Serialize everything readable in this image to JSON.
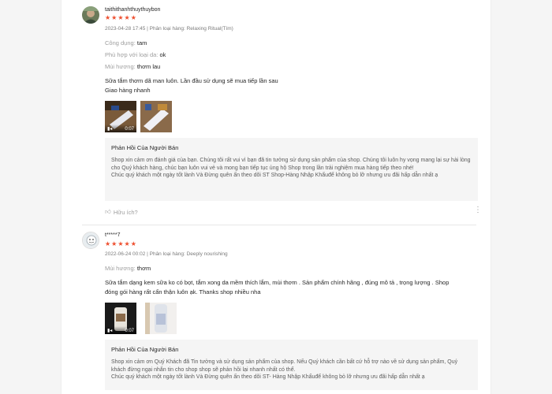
{
  "colors": {
    "star": "#ee4d2d",
    "reply_bg": "#f5f5f5"
  },
  "reviews": [
    {
      "author": "taithithanhthuythuybon",
      "stars": "★★★★★",
      "meta": "2023-04-28 17:45 | Phân loại hàng: Relaxing Ritual(Tím)",
      "attrs": [
        {
          "key": "Công dụng:",
          "value": "tam"
        },
        {
          "key": "Phù hợp với loại da:",
          "value": "ok"
        },
        {
          "key": "Mùi hương:",
          "value": "thơm lau"
        }
      ],
      "text_lines": [
        "Sữa tắm thơm dã man luôn. Lần đầu sử dụng sẽ mua tiếp lần sau",
        "Giao hàng nhanh"
      ],
      "media": [
        {
          "kind": "video",
          "duration": "0:07"
        },
        {
          "kind": "image"
        }
      ],
      "reply_title": "Phản Hồi Của Người Bán",
      "reply_text": "Shop xin cảm ơn đánh giá của bạn. Chúng tôi rất vui vì bạn đã tin tưởng sử dụng sản phẩm của shop. Chúng tôi luôn hy vọng mang lại sự hài lòng cho Quý khách hàng, chúc bạn luôn vui vẻ và mong bạn tiếp tục ủng hộ Shop trong lần trải nghiệm mua hàng tiếp theo nhé!\nChúc quý khách một ngày tốt lành Và Đừng quên ấn theo dõi  ST Shop-Hàng Nhập Khẩuđể không bỏ lỡ nhưng ưu đãi hấp dẫn nhất ạ",
      "helpful": "Hữu ích?"
    },
    {
      "author": "t*****7",
      "stars": "★★★★★",
      "meta": "2022-06-24 00:02 | Phân loại hàng: Deeply nourishing",
      "attrs": [
        {
          "key": "Mùi hương:",
          "value": "thơm"
        }
      ],
      "text_lines": [
        "Sữa tắm dạng kem sữa ko có bọt, tắm xong da mềm thích lắm, mùi thơm . Sản phẩm chính hãng , đúng mô tả , trọng lượng . Shop",
        "đóng gói hàng rất cẩn thận luôn ạk. Thanks shop nhiều nha"
      ],
      "media": [
        {
          "kind": "video",
          "duration": "0:07"
        },
        {
          "kind": "image"
        }
      ],
      "reply_title": "Phản Hồi Của Người Bán",
      "reply_text": "Shop xin cảm ơn Quý Khách đã Tin tưởng và sử dụng sản phẩm của shop. Nếu Quý khách cần bất cứ hỗ trợ nào về sử dụng sản phẩm, Quý khách đừng ngại nhắn tin cho shop shop sẽ phản hồi lại nhanh nhất có thể.\nChúc quý khách một ngày tốt lành Và Đừng quên ấn theo dõi  ST- Hàng Nhập Khẩuđể không bỏ lỡ nhưng ưu đãi hấp dẫn nhất ạ"
    }
  ]
}
